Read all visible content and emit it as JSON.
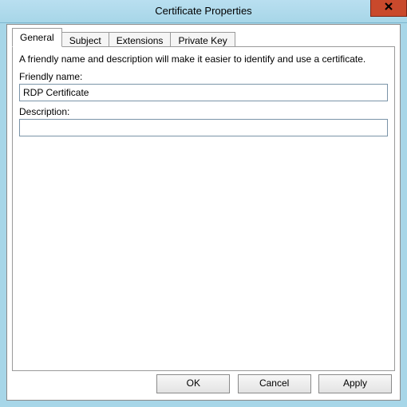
{
  "window": {
    "title": "Certificate Properties"
  },
  "tabs": {
    "t0": "General",
    "t1": "Subject",
    "t2": "Extensions",
    "t3": "Private Key"
  },
  "general": {
    "instruction": "A friendly name and description will make it easier to identify and use a certificate.",
    "friendly_name_label": "Friendly name:",
    "friendly_name_value": "RDP Certificate",
    "description_label": "Description:",
    "description_value": ""
  },
  "buttons": {
    "ok": "OK",
    "cancel": "Cancel",
    "apply": "Apply"
  }
}
